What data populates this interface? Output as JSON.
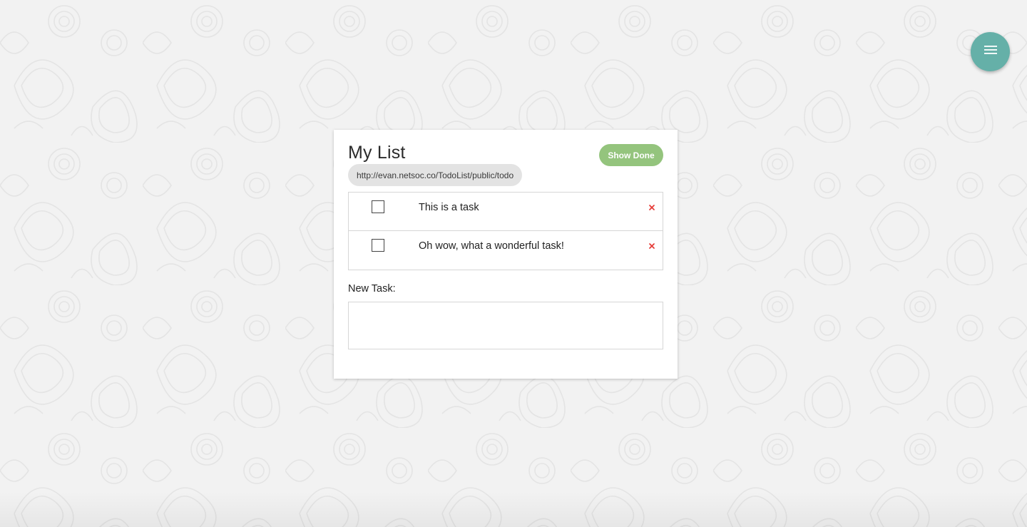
{
  "list": {
    "title": "My List",
    "url": "http://evan.netsoc.co/TodoList/public/todo",
    "show_done_label": "Show Done",
    "tasks": [
      {
        "text": "This is a task",
        "done": false
      },
      {
        "text": "Oh wow, what a wonderful task!",
        "done": false
      }
    ],
    "new_task_label": "New Task:",
    "new_task_value": ""
  },
  "fab": {
    "icon": "menu-icon"
  },
  "colors": {
    "fab": "#65b0a8",
    "show_done": "#94c47d",
    "delete": "#e53935",
    "url_chip": "#e3e3e3"
  }
}
